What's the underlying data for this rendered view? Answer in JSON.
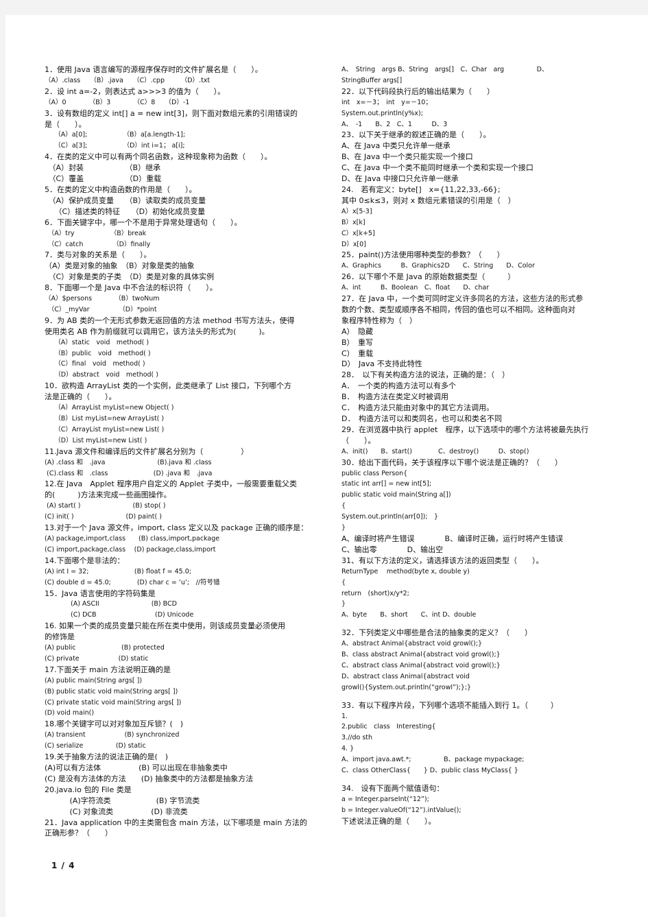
{
  "page_indicator": "1 / 4",
  "left_column": [
    {
      "t": "1．使用 Java 语言编写的源程序保存时的文件扩展名是（　　）。"
    },
    {
      "t": "（A）.class　　（B）.java　　（C）.cpp　　　（D）.txt",
      "s": 1
    },
    {
      "t": "2．设 int a=-2，则表达式 a>>>3 的值为（　　）。"
    },
    {
      "t": "（A）0　　　　（B）3　　　　（C）8　　（D）-1",
      "s": 1
    },
    {
      "t": "3．设有数组的定义 int[] a = new int[3]，则下面对数组元素的引用错误的"
    },
    {
      "t": "是（　　）。"
    },
    {
      "t": "　　（A）a[0];　　　　　　（B）a[a.length-1];",
      "s": 1
    },
    {
      "t": "　　（C）a[3];　　　　　　（D）int i=1； a[i];",
      "s": 1
    },
    {
      "t": "4．在类的定义中可以有两个同名函数，这种现象称为函数（　　）。"
    },
    {
      "t": "　（A）封装　　　　　　（B）继承"
    },
    {
      "t": "　（C）覆盖　　　　　　（D）重载"
    },
    {
      "t": "5．在类的定义中构造函数的作用是（　　）。"
    },
    {
      "t": "　（A）保护成员变量　　（B）读取类的成员变量"
    },
    {
      "t": "　 （C）描述类的特征　　（D）初始化成员变量"
    },
    {
      "t": "6．下面关键字中，哪一个不是用于异常处理语句（　　）。"
    },
    {
      "t": "　（A）try　　　　　　（B）break",
      "s": 1
    },
    {
      "t": "　（C）catch　　　　　（D）finally",
      "s": 1
    },
    {
      "t": "7．类与对象的关系是（　　）。"
    },
    {
      "t": "（A）类是对象的抽象　（B）对象是类的抽象"
    },
    {
      "t": "　（C）对象是类的子类　（D）类是对象的具体实例"
    },
    {
      "t": "8．下面哪一个是 Java 中不合法的标识符（　　）。"
    },
    {
      "t": "（A）$persons　　　　（B）twoNum",
      "s": 1
    },
    {
      "t": "　（C）_myVar　　　　　（D）*point",
      "s": 1
    },
    {
      "t": "9．为 AB 类的一个无形式参数无返回值的方法 method 书写方法头，使得"
    },
    {
      "t": "使用类名 AB 作为前缀就可以调用它，该方法头的形式为(　　　)。"
    },
    {
      "t": "　　（A）static　void　method( )",
      "s": 1
    },
    {
      "t": "　　（B）public　void　method( )",
      "s": 1
    },
    {
      "t": "　　（C）final　void　method( )",
      "s": 1
    },
    {
      "t": "　　（D）abstract　void　method( )",
      "s": 1
    },
    {
      "t": "10．欲构造 ArrayList 类的一个实例，此类继承了 List 接口，下列哪个方"
    },
    {
      "t": "法是正确的（　　）。"
    },
    {
      "t": "　　（A）ArrayList myList=new Object( )",
      "s": 1
    },
    {
      "t": "　　（B）List myList=new ArrayList( )",
      "s": 1
    },
    {
      "t": "　　（C）ArrayList myList=new List( )",
      "s": 1
    },
    {
      "t": "　　（D）List myList=new List( )",
      "s": 1
    },
    {
      "t": "11.Java 源文件和编译后的文件扩展名分别为（　　　　　）"
    },
    {
      "t": "(A) .class 和　.java　　　　　　　　(B).java 和 .class",
      "s": 1
    },
    {
      "t": " (C).class 和　.class　　　　　　　(D) .java 和　.java",
      "s": 1
    },
    {
      "t": "12.在 Java　Applet 程序用户自定义的 Applet 子类中，一般需要重载父类"
    },
    {
      "t": "的(　　　)方法来完成一些画图操作。"
    },
    {
      "t": " (A) start( )　　　　　　　　(B) stop( )",
      "s": 1
    },
    {
      "t": "(C) init( )　　　　　　　　(D) paint( )",
      "s": 1
    },
    {
      "t": "13.对于一个 Java 源文件，import, class 定义以及 package 正确的顺序是："
    },
    {
      "t": "(A) package,import,class　　(B) class,import,package",
      "s": 1
    },
    {
      "t": "(C) import,package,class　 (D) package,class,import",
      "s": 1
    },
    {
      "t": "14.下面哪个是非法的："
    },
    {
      "t": "(A) int I = 32;　　　　　　　(B) float f = 45.0;",
      "s": 1
    },
    {
      "t": "(C) double d = 45.0;　　　　(D) char c = ‘u’;　//符号错",
      "s": 1
    },
    {
      "t": "15．Java 语言使用的字符码集是"
    },
    {
      "t": "　　　　(A) ASCII　　　　　　　　(B) BCD",
      "s": 1
    },
    {
      "t": "　　　　(C) DCB　　　　　　　　　(D) Unicode",
      "s": 1
    },
    {
      "t": "16. 如果一个类的成员变量只能在所在类中使用，则该成员变量必须使用"
    },
    {
      "t": "的修饰是"
    },
    {
      "t": "(A) public　　　　　　　(B) protected",
      "s": 1
    },
    {
      "t": "(C) private　　　　　　(D) static",
      "s": 1
    },
    {
      "t": "17.下面关于 main 方法说明正确的是"
    },
    {
      "t": "(A) public main(String args[ ])",
      "s": 1
    },
    {
      "t": "(B) public static void main(String args[ ])",
      "s": 1
    },
    {
      "t": "(C) private static void main(String args[ ])",
      "s": 1
    },
    {
      "t": "(D) void main()",
      "s": 1
    },
    {
      "t": "18.哪个关键字可以对对象加互斥锁？(　)"
    },
    {
      "t": "(A) transient　　　　　　(B) synchronized",
      "s": 1
    },
    {
      "t": "(C) serialize　　　　　(D) static",
      "s": 1
    },
    {
      "t": "19.关于抽象方法的说法正确的是(　)"
    },
    {
      "t": "(A)可以有方法体　　　　　(B) 可以出现在非抽象类中"
    },
    {
      "t": "(C) 是没有方法体的方法　　(D) 抽象类中的方法都是抽象方法"
    },
    {
      "t": "20.java.io 包的 File 类是"
    },
    {
      "t": "　　　 (A)字符流类　　　　　　(B) 字节流类"
    },
    {
      "t": "　　　 (C) 对象流类　　　　　(D) 非流类"
    },
    {
      "t": "21．Java application 中的主类需包含 main 方法，以下哪项是 main 方法的"
    },
    {
      "t": "正确形参？（　　）"
    }
  ],
  "right_column": [
    {
      "t": "A、　String　args B、String　args[]　C、Char　arg　　　　　D、",
      "s": 1
    },
    {
      "t": "StringBuffer args[]",
      "s": 1
    },
    {
      "t": "22．以下代码段执行后的输出结果为（　　）"
    },
    {
      "t": "int　x=－3；　int　y=－10；",
      "s": 1
    },
    {
      "t": "System.out.println(y%x);",
      "s": 1
    },
    {
      "t": "A、　-1　　B、2　C、1　　　D、3",
      "s": 1
    },
    {
      "t": "23．以下关于继承的叙述正确的是（　　）。"
    },
    {
      "t": "A、在 Java 中类只允许单一继承"
    },
    {
      "t": "B、在 Java 中一个类只能实现一个接口"
    },
    {
      "t": "C、在 Java 中一个类不能同时继承一个类和实现一个接口"
    },
    {
      "t": "D、在 Java 中接口只允许单一继承"
    },
    {
      "t": "24.　若有定义：byte[]　x={11,22,33,-66};"
    },
    {
      "t": "其中 0≤k≤3，则对 x 数组元素错误的引用是（　）"
    },
    {
      "t": "A）x[5-3]",
      "s": 1
    },
    {
      "t": "B）x[k]",
      "s": 1
    },
    {
      "t": "C）x[k+5]",
      "s": 1
    },
    {
      "t": "D）x[0]",
      "s": 1
    },
    {
      "t": "25．paint()方法使用哪种类型的参数？（　　）"
    },
    {
      "t": "A、Graphics　　　B、Graphics2D　　C、String　　D、Color",
      "s": 1
    },
    {
      "t": "26．以下哪个不是 Java 的原始数据类型（　　　）"
    },
    {
      "t": "A、int　　　B、Boolean　C、float　　D、char",
      "s": 1
    },
    {
      "t": "27．在 Java 中，一个类可同时定义许多同名的方法，这些方法的形式参"
    },
    {
      "t": "数的个数、类型或顺序各不相同，传回的值也可以不相同。这种面向对"
    },
    {
      "t": "象程序特性称为（　）"
    },
    {
      "t": "A）　隐藏"
    },
    {
      "t": "B）　重写"
    },
    {
      "t": "C）　重载"
    },
    {
      "t": "D）　Java 不支持此特性"
    },
    {
      "t": "28．　以下有关构造方法的说法，正确的是：（　）"
    },
    {
      "t": "A．　一个类的构造方法可以有多个"
    },
    {
      "t": "B．　构造方法在类定义时被调用"
    },
    {
      "t": "C．　构造方法只能由对象中的其它方法调用。"
    },
    {
      "t": "D．　构造方法可以和类同名，也可以和类名不同"
    },
    {
      "t": "29．在浏览器中执行 applet　程序，以下选项中的哪个方法将被最先执行"
    },
    {
      "t": "（　　）。"
    },
    {
      "t": "A、init()　　B、start()　　　　C、destroy()　　　D、stop()",
      "s": 1
    },
    {
      "t": "30．给出下面代码，关于该程序以下哪个说法是正确的？（　　）"
    },
    {
      "t": "public class Person{",
      "s": 1
    },
    {
      "t": "static int arr[] = new int[5];",
      "s": 1
    },
    {
      "t": "public static void main(String a[])",
      "s": 1
    },
    {
      "t": "{",
      "s": 1
    },
    {
      "t": "System.out.println(arr[0]);　}",
      "s": 1
    },
    {
      "t": "}",
      "s": 1
    },
    {
      "t": "A、编译时将产生错误　　　　B、编译时正确，运行时将产生错误"
    },
    {
      "t": "C、输出零　　　　D、输出空"
    },
    {
      "t": "31、有以下方法的定义，请选择该方法的返回类型（　　）。"
    },
    {
      "t": "ReturnType　 method(byte x, double y)",
      "s": 1
    },
    {
      "t": "{",
      "s": 1
    },
    {
      "t": "return　(short)x/y*2;",
      "s": 1
    },
    {
      "t": "}",
      "s": 1
    },
    {
      "t": "A、byte　　B、short　　C、int D、double",
      "s": 1
    },
    {
      "t": "",
      "gap": 1
    },
    {
      "t": "32．下列类定义中哪些是合法的抽象类的定义？（　　）"
    },
    {
      "t": "A、abstract Animal{abstract void growl();}",
      "s": 1
    },
    {
      "t": "B、class abstract Animal{abstract void growl();}",
      "s": 1
    },
    {
      "t": "C、abstract class Animal{abstract void growl();}",
      "s": 1
    },
    {
      "t": "D、abstract class Animal{abstract void",
      "s": 1
    },
    {
      "t": "growl(){System.out.println(“growl”);};}",
      "s": 1
    },
    {
      "t": "",
      "gap": 1
    },
    {
      "t": "33．有以下程序片段，下列哪个选项不能插入到行 1。（　　　）"
    },
    {
      "t": "1.",
      "s": 1
    },
    {
      "t": "2.public　class　Interesting{",
      "s": 1
    },
    {
      "t": "3.//do sth",
      "s": 1
    },
    {
      "t": "4. }",
      "s": 1
    },
    {
      "t": "A、import java.awt.*;　　　　　B、package mypackage;",
      "s": 1
    },
    {
      "t": "C、class OtherClass{　　} D、public class MyClass{ }",
      "s": 1
    },
    {
      "t": "",
      "gap": 1
    },
    {
      "t": "34.　设有下面两个赋值语句："
    },
    {
      "t": "a = Integer.parseInt(“12”);",
      "s": 1
    },
    {
      "t": "b = Integer.valueOf(“12”).intValue();",
      "s": 1
    },
    {
      "t": "下述说法正确的是（　　）。"
    }
  ]
}
